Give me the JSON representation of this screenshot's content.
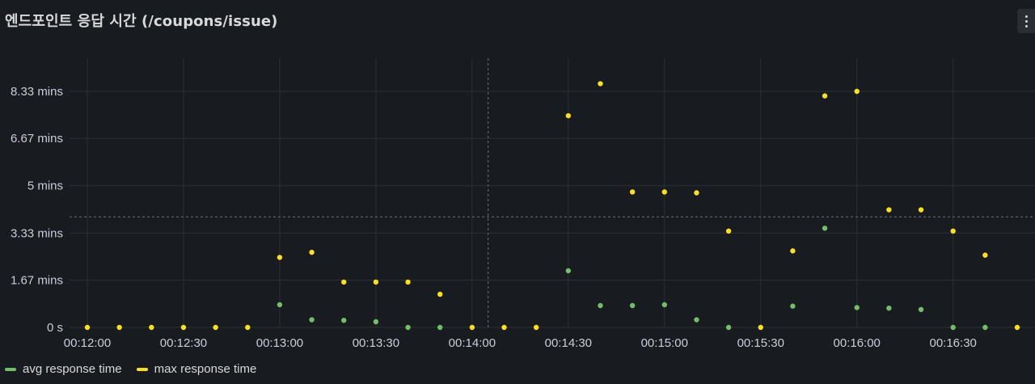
{
  "panel": {
    "title": "엔드포인트 응답 시간 (/coupons/issue)",
    "menu_icon": "kebab-menu-icon"
  },
  "colors": {
    "background": "#181b1f",
    "grid": "#2c2f35",
    "axis_text": "#ccccdc",
    "avg": "#73bf69",
    "max": "#fade2a",
    "crosshair": "#6e7079"
  },
  "chart_data": {
    "type": "scatter",
    "title": "엔드포인트 응답 시간 (/coupons/issue)",
    "xlabel": "",
    "ylabel": "",
    "x_ticks": [
      "00:12:00",
      "00:12:30",
      "00:13:00",
      "00:13:30",
      "00:14:00",
      "00:14:30",
      "00:15:00",
      "00:15:30",
      "00:16:00",
      "00:16:30"
    ],
    "xlim": [
      "00:12:00",
      "00:16:50"
    ],
    "y_unit": "mins",
    "y_ticks": [
      {
        "value": 0,
        "label": "0 s"
      },
      {
        "value": 1.67,
        "label": "1.67 mins"
      },
      {
        "value": 3.33,
        "label": "3.33 mins"
      },
      {
        "value": 5,
        "label": "5 mins"
      },
      {
        "value": 6.67,
        "label": "6.67 mins"
      },
      {
        "value": 8.33,
        "label": "8.33 mins"
      }
    ],
    "ylim": [
      0,
      9.5
    ],
    "grid": true,
    "legend_position": "bottom-left",
    "crosshair": {
      "x": "00:14:05",
      "y": 3.9
    },
    "series": [
      {
        "name": "avg response time",
        "points": [
          [
            "00:13:00",
            0.8
          ],
          [
            "00:13:10",
            0.27
          ],
          [
            "00:13:20",
            0.25
          ],
          [
            "00:13:30",
            0.2
          ],
          [
            "00:13:40",
            0
          ],
          [
            "00:13:50",
            0
          ],
          [
            "00:14:30",
            2.0
          ],
          [
            "00:14:40",
            0.77
          ],
          [
            "00:14:50",
            0.77
          ],
          [
            "00:15:00",
            0.8
          ],
          [
            "00:15:10",
            0.27
          ],
          [
            "00:15:20",
            0
          ],
          [
            "00:15:40",
            0.75
          ],
          [
            "00:15:50",
            3.5
          ],
          [
            "00:16:00",
            0.7
          ],
          [
            "00:16:10",
            0.68
          ],
          [
            "00:16:20",
            0.63
          ],
          [
            "00:16:30",
            0
          ],
          [
            "00:16:40",
            0
          ]
        ]
      },
      {
        "name": "max response time",
        "points": [
          [
            "00:12:00",
            0
          ],
          [
            "00:12:10",
            0
          ],
          [
            "00:12:20",
            0
          ],
          [
            "00:12:30",
            0
          ],
          [
            "00:12:40",
            0
          ],
          [
            "00:12:50",
            0
          ],
          [
            "00:13:00",
            2.47
          ],
          [
            "00:13:10",
            2.65
          ],
          [
            "00:13:20",
            1.6
          ],
          [
            "00:13:30",
            1.6
          ],
          [
            "00:13:40",
            1.6
          ],
          [
            "00:13:50",
            1.17
          ],
          [
            "00:14:00",
            0
          ],
          [
            "00:14:10",
            0
          ],
          [
            "00:14:20",
            0
          ],
          [
            "00:14:30",
            7.47
          ],
          [
            "00:14:40",
            8.6
          ],
          [
            "00:14:50",
            4.78
          ],
          [
            "00:15:00",
            4.78
          ],
          [
            "00:15:10",
            4.75
          ],
          [
            "00:15:20",
            3.4
          ],
          [
            "00:15:30",
            0
          ],
          [
            "00:15:40",
            2.7
          ],
          [
            "00:15:50",
            8.17
          ],
          [
            "00:16:00",
            8.33
          ],
          [
            "00:16:10",
            4.15
          ],
          [
            "00:16:20",
            4.15
          ],
          [
            "00:16:30",
            3.4
          ],
          [
            "00:16:40",
            2.55
          ],
          [
            "00:16:50",
            0
          ]
        ]
      }
    ]
  },
  "legend": {
    "items": [
      {
        "label": "avg response time",
        "color": "#73bf69"
      },
      {
        "label": "max response time",
        "color": "#fade2a"
      }
    ]
  }
}
